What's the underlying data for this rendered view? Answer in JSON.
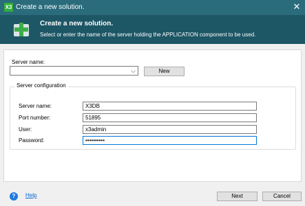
{
  "window": {
    "title": "Create a new solution.",
    "app_icon_text": "X3",
    "close_glyph": "✕"
  },
  "header": {
    "title": "Create a new solution.",
    "subtitle": "Select or enter the name of the server holding the APPLICATION component to be used.",
    "icon": "plus-server-icon"
  },
  "server": {
    "label": "Server name:",
    "value": "",
    "dropdown_glyph": "⌵",
    "new_button": "New"
  },
  "config": {
    "group_title": "Server configuration",
    "fields": [
      {
        "label": "Server name:",
        "value": "X3DB"
      },
      {
        "label": "Port number:",
        "value": "51895"
      },
      {
        "label": "User:",
        "value": "x3admin"
      },
      {
        "label": "Password:",
        "value": "••••••••••"
      }
    ]
  },
  "footer": {
    "help_icon_glyph": "?",
    "help_label": "Help",
    "next_button": "Next",
    "cancel_button": "Cancel"
  },
  "colors": {
    "titlebar": "#2b6c7c",
    "header_band": "#1d5665",
    "accent": "#0078d7",
    "app_icon": "#2fae3a"
  }
}
